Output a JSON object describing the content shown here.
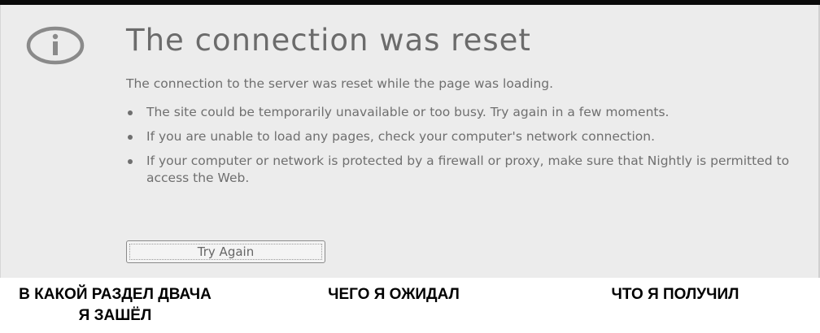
{
  "error_page": {
    "icon": "info-icon",
    "title": "The connection was reset",
    "lead": "The connection to the server was reset while the page was loading.",
    "reasons": [
      "The site could be temporarily unavailable or too busy. Try again in a few moments.",
      "If you are unable to load any pages, check your computer's network connection.",
      "If your computer or network is protected by a firewall or proxy, make sure that Nightly is permitted to access the Web."
    ],
    "try_again_label": "Try Again"
  },
  "captions": [
    "В КАКОЙ РАЗДЕЛ ДВАЧА\nЯ ЗАШЁЛ",
    "ЧЕГО Я ОЖИДАЛ",
    "ЧТО Я ПОЛУЧИЛ"
  ],
  "colors": {
    "panel_background": "#ececec",
    "text": "#6f6f6f",
    "icon": "#8a8a8a",
    "caption_text": "#000000"
  }
}
